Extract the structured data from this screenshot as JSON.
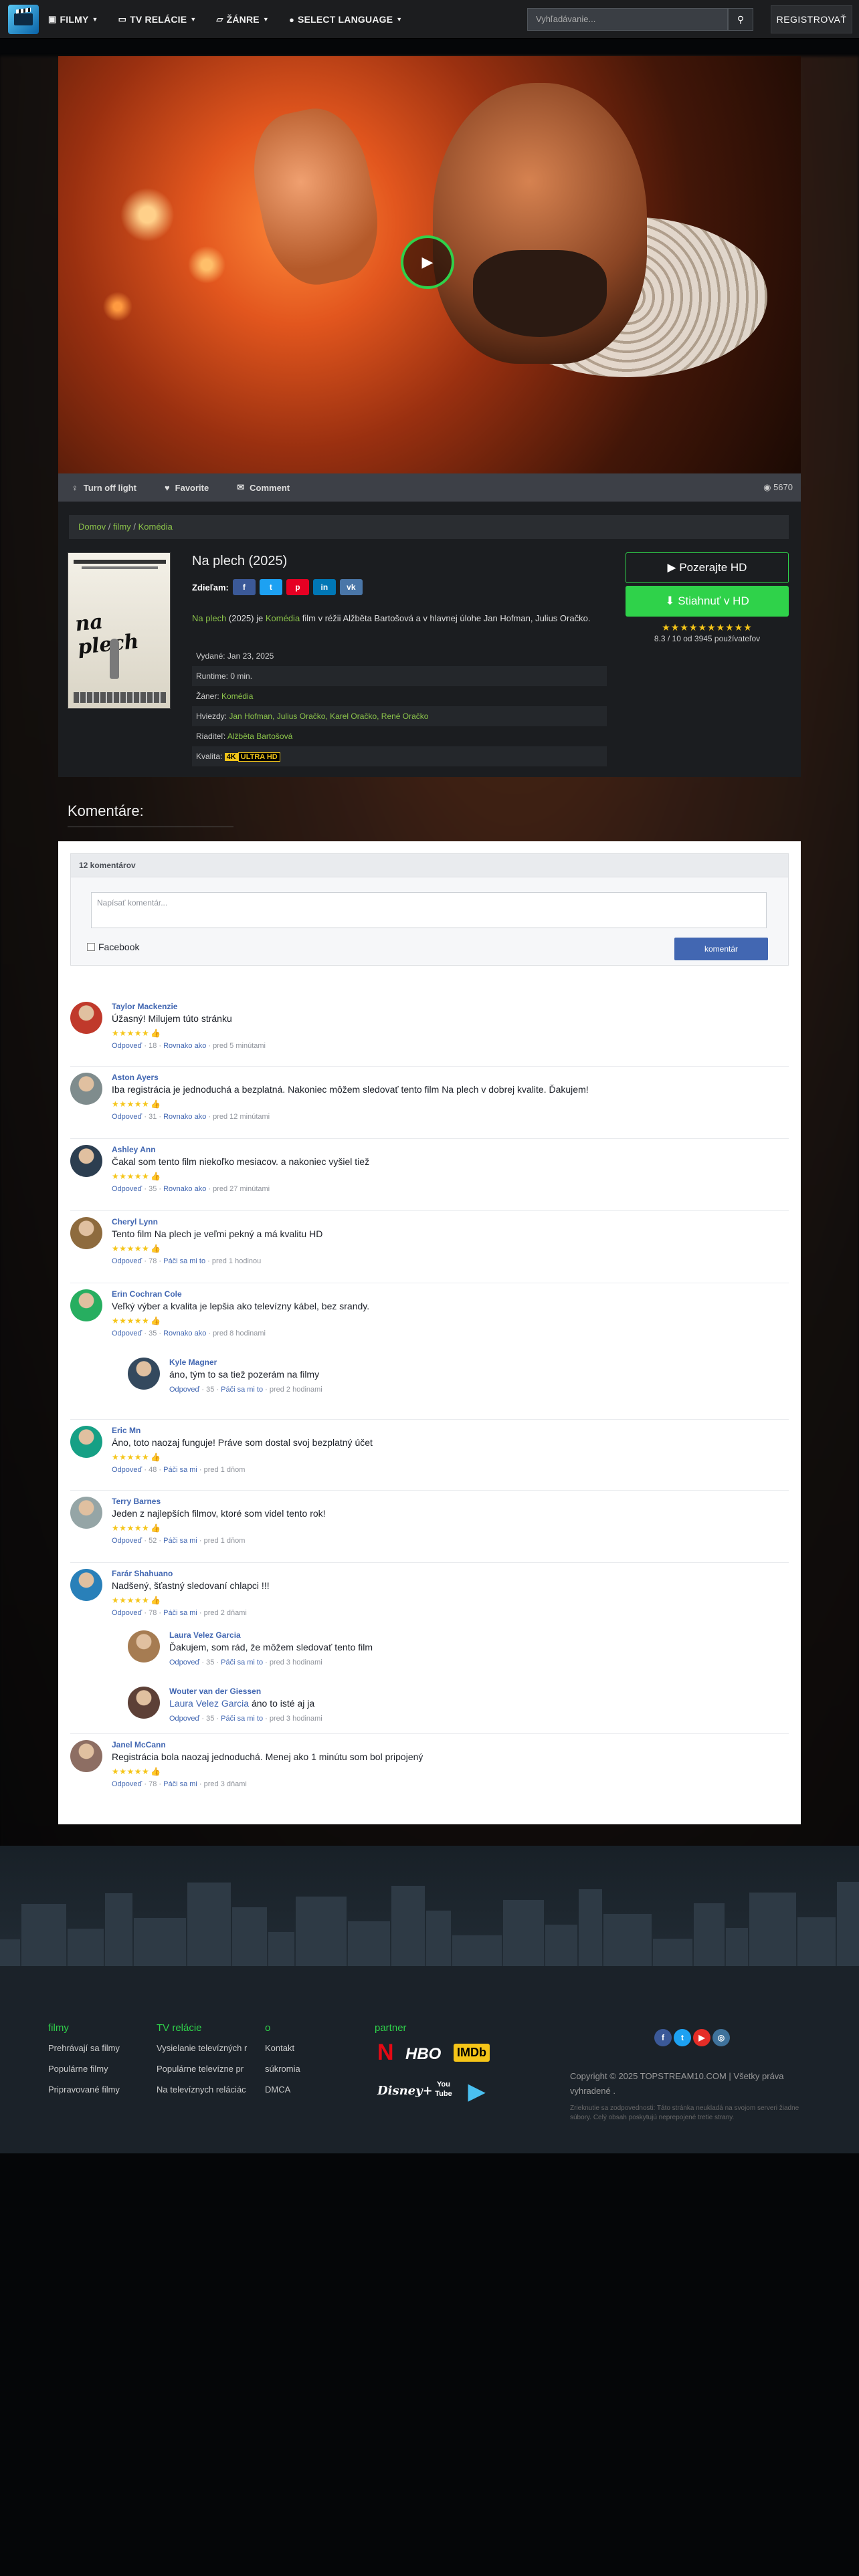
{
  "nav": {
    "items": [
      {
        "icon": "film-icon",
        "label": "FILMY"
      },
      {
        "icon": "tv-icon",
        "label": "TV RELÁCIE"
      },
      {
        "icon": "folder-icon",
        "label": "ŽÁNRE"
      },
      {
        "icon": "globe-icon",
        "label": "SELECT LANGUAGE"
      }
    ],
    "search_placeholder": "Vyhľadávanie...",
    "register": "REGISTROVAŤ"
  },
  "player": {
    "bar": {
      "light": "Turn off light",
      "favorite": "Favorite",
      "comment": "Comment",
      "views": "5670"
    }
  },
  "breadcrumb": [
    "Domov",
    "filmy",
    "Komédia"
  ],
  "movie": {
    "title": "Na plech (2025)",
    "share_label": "Zdieľam:",
    "poster_title": "na plech",
    "desc": {
      "link": "Na plech",
      "a": " (2025) je ",
      "genre": "Komédia",
      "b": " film v réžii  Alžběta Bartošová a v hlavnej úlohe  Jan Hofman, Julius Oračko."
    },
    "meta": {
      "released": "Vydané: Jan 23, 2025",
      "runtime": "Runtime: 0 min.",
      "genre_label": "Žáner: ",
      "genre": "Komédia",
      "stars_label": "Hviezdy: ",
      "stars": "Jan Hofman, Julius Oračko, Karel Oračko, René Oračko",
      "director_label": "Riaditeľ: ",
      "director": "Alžběta Bartošová",
      "quality_label": "Kvalita: ",
      "q1": "4K",
      "q2": "ULTRA HD"
    },
    "watch": "Pozerajte HD",
    "download": "Stiahnuť v HD",
    "rating_stars": "★★★★★★★★★★",
    "rating": "8.3 / 10 od 3945 používateľov"
  },
  "comments": {
    "heading": "Komentáre:",
    "count": "12 komentárov",
    "placeholder": "Napísať komentár...",
    "facebook": "Facebook",
    "post": "komentár",
    "list": [
      {
        "name": "Taylor Mackenzie",
        "text": "Úžasný! Milujem túto stránku",
        "stars": "★★★★★",
        "actions": [
          "Odpoveď",
          "18",
          "Rovnako ako",
          "pred 5 minútami"
        ]
      },
      {
        "name": "Aston Ayers",
        "text": "Iba registrácia je jednoduchá a bezplatná. Nakoniec môžem sledovať tento film Na plech v dobrej kvalite. Ďakujem!",
        "stars": "★★★★★",
        "actions": [
          "Odpoveď",
          "31",
          "Rovnako ako",
          "pred 12 minútami"
        ]
      },
      {
        "name": "Ashley Ann",
        "text": "Čakal som tento film niekoľko mesiacov. a nakoniec vyšiel tiež",
        "stars": "★★★★★",
        "actions": [
          "Odpoveď",
          "35",
          "Rovnako ako",
          "pred 27 minútami"
        ]
      },
      {
        "name": "Cheryl Lynn",
        "text": "Tento film Na plech je veľmi pekný a má kvalitu HD",
        "stars": "★★★★★",
        "actions": [
          "Odpoveď",
          "78",
          "Páči sa mi to",
          "pred 1 hodinou"
        ]
      },
      {
        "name": "Erin Cochran Cole",
        "text": "Veľký výber a kvalita je lepšia ako televízny kábel, bez srandy.",
        "stars": "★★★★★",
        "actions": [
          "Odpoveď",
          "35",
          "Rovnako ako",
          "pred 8 hodinami"
        ]
      },
      {
        "name": "Kyle Magner",
        "text": "áno, tým to sa tiež pozerám na filmy",
        "stars": "",
        "actions": [
          "Odpoveď",
          "35",
          "Páči sa mi to",
          "pred 2 hodinami"
        ]
      },
      {
        "name": "Eric Mn",
        "text": "Áno, toto naozaj funguje! Práve som dostal svoj bezplatný účet",
        "stars": "★★★★★",
        "actions": [
          "Odpoveď",
          "48",
          "Páči sa mi",
          "pred 1 dňom"
        ]
      },
      {
        "name": "Terry Barnes",
        "text": "Jeden z najlepších filmov, ktoré som videl tento rok!",
        "stars": "★★★★★",
        "actions": [
          "Odpoveď",
          "52",
          "Páči sa mi",
          "pred 1 dňom"
        ]
      },
      {
        "name": "Farár Shahuano",
        "text": "Nadšený, šťastný sledovaní chlapci !!!",
        "stars": "★★★★★",
        "actions": [
          "Odpoveď",
          "78",
          "Páči sa mi",
          "pred 2 dňami"
        ]
      },
      {
        "name": "Laura Velez Garcia",
        "text": "Ďakujem, som rád, že môžem sledovať tento film",
        "stars": "",
        "actions": [
          "Odpoveď",
          "35",
          "Páči sa mi to",
          "pred 3 hodinami"
        ]
      },
      {
        "name": "Wouter van der Giessen",
        "mention": "Laura Velez Garcia",
        "text": " áno to isté aj ja",
        "stars": "",
        "actions": [
          "Odpoveď",
          "35",
          "Páči sa mi to",
          "pred 3 hodinami"
        ]
      },
      {
        "name": "Janel McCann",
        "text": "Registrácia bola naozaj jednoduchá. Menej ako 1 minútu som bol pripojený",
        "stars": "★★★★★",
        "actions": [
          "Odpoveď",
          "78",
          "Páči sa mi",
          "pred 3 dňami"
        ]
      }
    ]
  },
  "footer": {
    "col1": {
      "h": "filmy",
      "items": [
        "Prehrávají sa filmy",
        "Populárne filmy",
        "Pripravované filmy"
      ]
    },
    "col2": {
      "h": "TV relácie",
      "items": [
        "Vysielanie televízných r",
        "Populárne televízne pr",
        "Na televíznych reláciác"
      ]
    },
    "col3": {
      "h": "o",
      "items": [
        "Kontakt",
        "súkromia",
        "DMCA"
      ]
    },
    "partner": "partner",
    "partners": [
      "N",
      "HBO",
      "IMDb",
      "Disney+",
      "You Tube",
      "▶"
    ],
    "copyright": "Copyright ©  2025 TOPSTREAM10.COM | Všetky práva vyhradené .",
    "disclaimer": "Zrieknutie sa zodpovednosti: Táto stránka neukladá na svojom serveri žiadne súbory. Celý obsah poskytujú neprepojené tretie strany."
  }
}
